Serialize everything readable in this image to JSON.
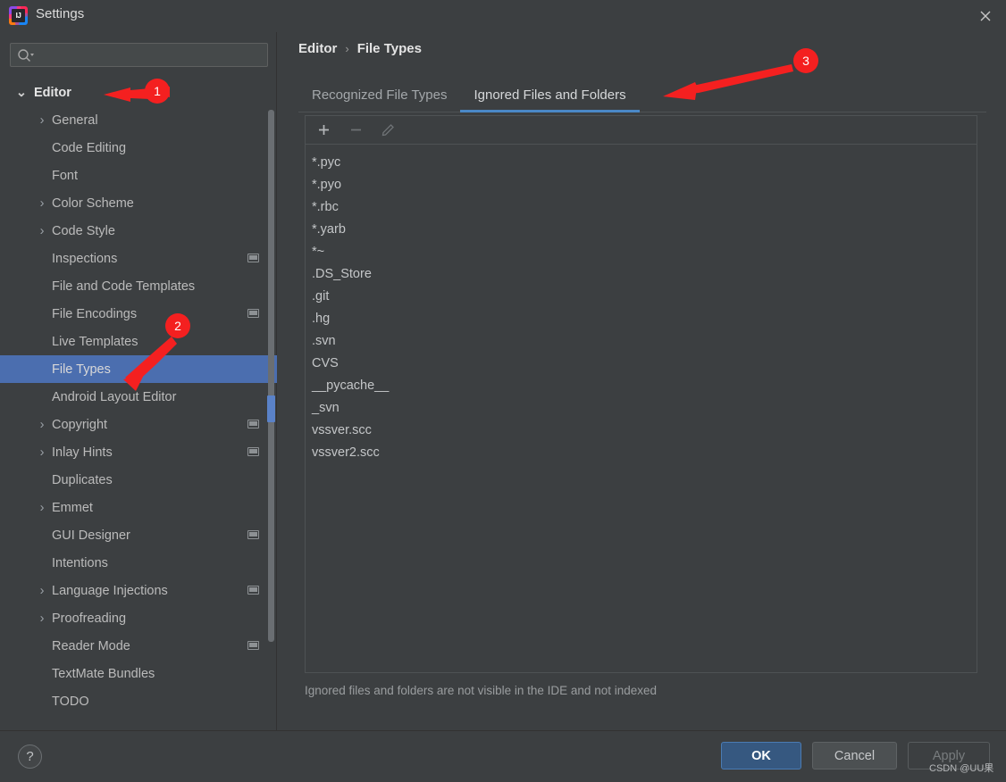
{
  "window": {
    "title": "Settings",
    "logo_text": "IJ",
    "close_label": "✕"
  },
  "sidebar": {
    "search": {
      "value": "",
      "placeholder": ""
    },
    "items": [
      {
        "label": "Editor",
        "level": 0,
        "chevron": "⌄",
        "expanded": true,
        "selected": false,
        "badge": false
      },
      {
        "label": "General",
        "level": 1,
        "chevron": "›",
        "expanded": false,
        "selected": false,
        "badge": false
      },
      {
        "label": "Code Editing",
        "level": 1,
        "chevron": "",
        "expanded": false,
        "selected": false,
        "badge": false
      },
      {
        "label": "Font",
        "level": 1,
        "chevron": "",
        "expanded": false,
        "selected": false,
        "badge": false
      },
      {
        "label": "Color Scheme",
        "level": 1,
        "chevron": "›",
        "expanded": false,
        "selected": false,
        "badge": false
      },
      {
        "label": "Code Style",
        "level": 1,
        "chevron": "›",
        "expanded": false,
        "selected": false,
        "badge": false
      },
      {
        "label": "Inspections",
        "level": 1,
        "chevron": "",
        "expanded": false,
        "selected": false,
        "badge": true
      },
      {
        "label": "File and Code Templates",
        "level": 1,
        "chevron": "",
        "expanded": false,
        "selected": false,
        "badge": false
      },
      {
        "label": "File Encodings",
        "level": 1,
        "chevron": "",
        "expanded": false,
        "selected": false,
        "badge": true
      },
      {
        "label": "Live Templates",
        "level": 1,
        "chevron": "",
        "expanded": false,
        "selected": false,
        "badge": false
      },
      {
        "label": "File Types",
        "level": 1,
        "chevron": "",
        "expanded": false,
        "selected": true,
        "badge": false
      },
      {
        "label": "Android Layout Editor",
        "level": 1,
        "chevron": "",
        "expanded": false,
        "selected": false,
        "badge": false
      },
      {
        "label": "Copyright",
        "level": 1,
        "chevron": "›",
        "expanded": false,
        "selected": false,
        "badge": true
      },
      {
        "label": "Inlay Hints",
        "level": 1,
        "chevron": "›",
        "expanded": false,
        "selected": false,
        "badge": true
      },
      {
        "label": "Duplicates",
        "level": 1,
        "chevron": "",
        "expanded": false,
        "selected": false,
        "badge": false
      },
      {
        "label": "Emmet",
        "level": 1,
        "chevron": "›",
        "expanded": false,
        "selected": false,
        "badge": false
      },
      {
        "label": "GUI Designer",
        "level": 1,
        "chevron": "",
        "expanded": false,
        "selected": false,
        "badge": true
      },
      {
        "label": "Intentions",
        "level": 1,
        "chevron": "",
        "expanded": false,
        "selected": false,
        "badge": false
      },
      {
        "label": "Language Injections",
        "level": 1,
        "chevron": "›",
        "expanded": false,
        "selected": false,
        "badge": true
      },
      {
        "label": "Proofreading",
        "level": 1,
        "chevron": "›",
        "expanded": false,
        "selected": false,
        "badge": false
      },
      {
        "label": "Reader Mode",
        "level": 1,
        "chevron": "",
        "expanded": false,
        "selected": false,
        "badge": true
      },
      {
        "label": "TextMate Bundles",
        "level": 1,
        "chevron": "",
        "expanded": false,
        "selected": false,
        "badge": false
      },
      {
        "label": "TODO",
        "level": 1,
        "chevron": "",
        "expanded": false,
        "selected": false,
        "badge": false
      }
    ]
  },
  "main": {
    "breadcrumb": {
      "root": "Editor",
      "separator": "›",
      "current": "File Types"
    },
    "tabs": [
      {
        "label": "Recognized File Types",
        "active": false
      },
      {
        "label": "Ignored Files and Folders",
        "active": true
      }
    ],
    "toolbar": {
      "add_label": "+",
      "remove_label": "−",
      "edit_label": "edit-pencil"
    },
    "ignored_entries": [
      "*.pyc",
      "*.pyo",
      "*.rbc",
      "*.yarb",
      "*~",
      ".DS_Store",
      ".git",
      ".hg",
      ".svn",
      "CVS",
      "__pycache__",
      "_svn",
      "vssver.scc",
      "vssver2.scc"
    ],
    "hint": "Ignored files and folders are not visible in the IDE and not indexed"
  },
  "footer": {
    "help_label": "?",
    "ok_label": "OK",
    "cancel_label": "Cancel",
    "apply_label": "Apply",
    "watermark": "CSDN @UU果"
  },
  "annotations": [
    {
      "number": "1",
      "target": "sidebar-item-editor"
    },
    {
      "number": "2",
      "target": "sidebar-item-file-types"
    },
    {
      "number": "3",
      "target": "tab-ignored-files-and-folders"
    }
  ],
  "colors": {
    "accent": "#4a88c7",
    "selection": "#4b6eaf",
    "annotation": "#f42020",
    "ok_button": "#365880",
    "background": "#3c3f41"
  }
}
